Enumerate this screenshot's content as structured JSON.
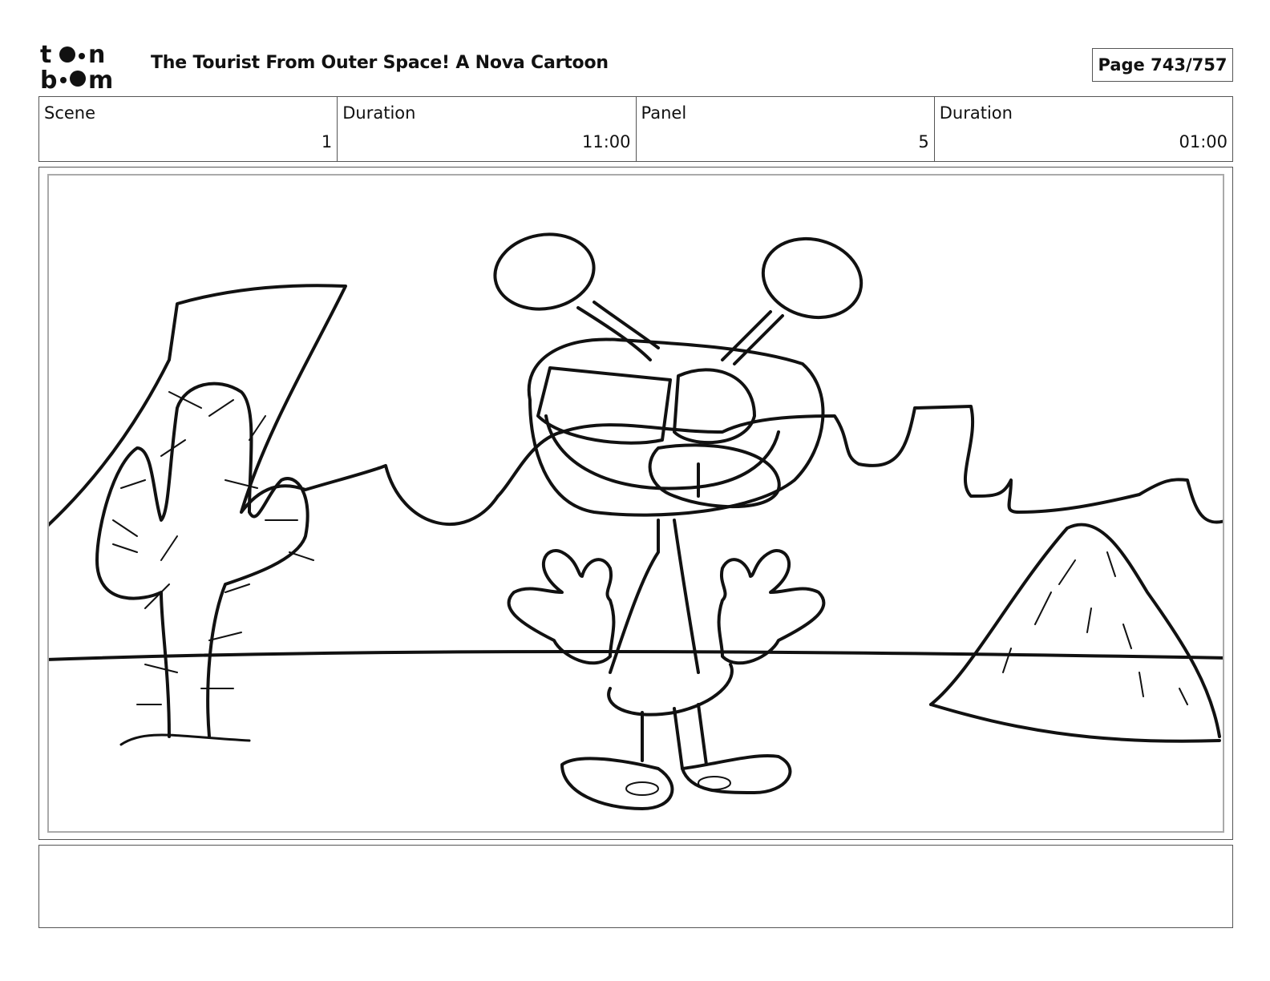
{
  "header": {
    "logo_text": "toonboom",
    "title": "The Tourist From Outer Space!  A Nova Cartoon",
    "page": "Page 743/757"
  },
  "info": {
    "scene_label": "Scene",
    "scene_value": "1",
    "scene_duration_label": "Duration",
    "scene_duration_value": "11:00",
    "panel_label": "Panel",
    "panel_value": "5",
    "panel_duration_label": "Duration",
    "panel_duration_value": "01:00"
  },
  "notes": {
    "text": ""
  },
  "colors": {
    "ink": "#111111",
    "border": "#555555",
    "inner_border": "#aaaaaa"
  }
}
